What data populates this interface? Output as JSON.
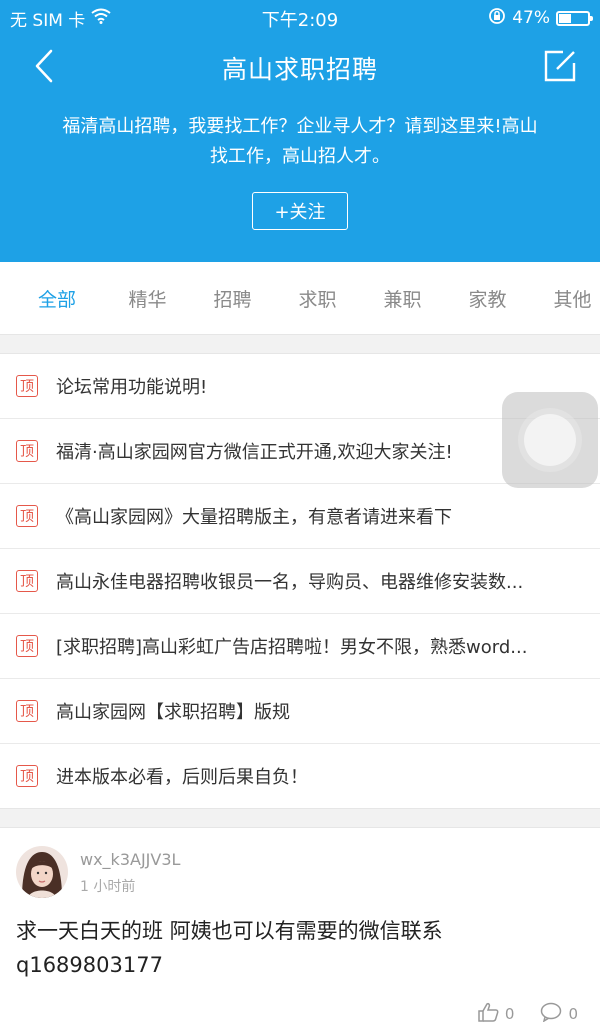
{
  "status_bar": {
    "carrier": "无 SIM 卡",
    "time": "下午2:09",
    "battery": "47%",
    "battery_level": 0.47
  },
  "header": {
    "title": "高山求职招聘",
    "description": "福清高山招聘，我要找工作？企业寻人才？请到这里来!高山找工作，高山招人才。",
    "follow_label": "+关注",
    "accent_color": "#1ea1e6"
  },
  "tabs": [
    {
      "label": "全部",
      "active": true
    },
    {
      "label": "精华"
    },
    {
      "label": "招聘"
    },
    {
      "label": "求职"
    },
    {
      "label": "兼职"
    },
    {
      "label": "家教"
    },
    {
      "label": "其他"
    }
  ],
  "pinned_badge": "顶",
  "pinned": [
    {
      "title": "论坛常用功能说明!"
    },
    {
      "title": "福清·高山家园网官方微信正式开通,欢迎大家关注!"
    },
    {
      "title": "《高山家园网》大量招聘版主，有意者请进来看下"
    },
    {
      "title": "高山永佳电器招聘收银员一名，导购员、电器维修安装数..."
    },
    {
      "title": "[求职招聘]高山彩虹广告店招聘啦！男女不限，熟悉word..."
    },
    {
      "title": "高山家园网【求职招聘】版规"
    },
    {
      "title": "进本版本必看，后则后果自负！"
    }
  ],
  "post": {
    "username": "wx_k3AJJV3L",
    "time": "1 小时前",
    "content": "求一天白天的班 阿姨也可以有需要的微信联系q1689803177",
    "likes": "0",
    "comments": "0"
  },
  "icons": {
    "back": "chevron-left-icon",
    "edit": "edit-icon",
    "wifi": "wifi-icon",
    "lock": "rotation-lock-icon",
    "like": "thumbs-up-icon",
    "comment": "comment-icon"
  }
}
